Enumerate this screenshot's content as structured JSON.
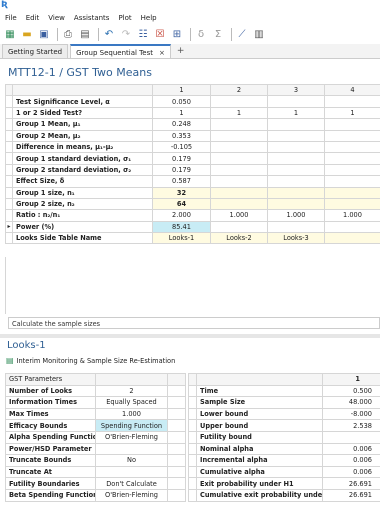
{
  "menu": [
    "File",
    "Edit",
    "View",
    "Assistants",
    "Plot",
    "Help"
  ],
  "tabs": [
    {
      "label": "Getting Started",
      "active": false
    },
    {
      "label": "Group Sequential Test",
      "active": true
    }
  ],
  "tab_add": "+",
  "doc_title": "MTT12-1 / GST Two Means",
  "main_grid": {
    "columns": [
      "",
      "1",
      "2",
      "3",
      "4"
    ],
    "rows": [
      {
        "label": "Test Significance Level, α",
        "values": [
          "0.050",
          "",
          "",
          ""
        ]
      },
      {
        "label": "1 or 2 Sided Test?",
        "values": [
          "1",
          "1",
          "1",
          "1"
        ]
      },
      {
        "label": "Group 1 Mean, μ₁",
        "values": [
          "0.248",
          "",
          "",
          ""
        ]
      },
      {
        "label": "Group 2 Mean, μ₂",
        "values": [
          "0.353",
          "",
          "",
          ""
        ]
      },
      {
        "label": "Difference in means, μ₁-μ₂",
        "values": [
          "-0.105",
          "",
          "",
          ""
        ]
      },
      {
        "label": "Group 1 standard deviation, σ₁",
        "values": [
          "0.179",
          "",
          "",
          ""
        ]
      },
      {
        "label": "Group 2 standard deviation, σ₂",
        "values": [
          "0.179",
          "",
          "",
          ""
        ]
      },
      {
        "label": "Effect Size, δ",
        "values": [
          "0.587",
          "",
          "",
          ""
        ]
      },
      {
        "label": "Group 1 size, n₁",
        "values": [
          "32",
          "",
          "",
          ""
        ]
      },
      {
        "label": "Group 2 size, n₂",
        "values": [
          "64",
          "",
          "",
          ""
        ]
      },
      {
        "label": "Ratio : n₂/n₁",
        "values": [
          "2.000",
          "1.000",
          "1.000",
          "1.000"
        ]
      },
      {
        "label": "Power (%)",
        "values": [
          "85.41",
          "",
          "",
          ""
        ]
      },
      {
        "label": "Looks Side Table Name",
        "values": [
          "Looks-1",
          "Looks-2",
          "Looks-3",
          ""
        ]
      }
    ]
  },
  "status_text": "Calculate the sample sizes",
  "looks_title": "Looks-1",
  "looks_subtitle": "Interim Monitoring & Sample Size Re-Estimation",
  "gst_params": {
    "header": "GST Parameters",
    "rows": [
      {
        "label": "Number of Looks",
        "value": "2"
      },
      {
        "label": "Information Times",
        "value": "Equally Spaced"
      },
      {
        "label": "Max Times",
        "value": "1.000"
      },
      {
        "label": "Efficacy Bounds",
        "value": "Spending Function"
      },
      {
        "label": "Alpha Spending Function",
        "value": "O'Brien-Fleming"
      },
      {
        "label": "Power/HSD Parameter",
        "value": ""
      },
      {
        "label": "Truncate Bounds",
        "value": "No"
      },
      {
        "label": "Truncate At",
        "value": ""
      },
      {
        "label": "Futility Boundaries",
        "value": "Don't Calculate"
      },
      {
        "label": "Beta Spending Function",
        "value": "O'Brien-Fleming"
      }
    ]
  },
  "looks_results": {
    "column": "1",
    "rows": [
      {
        "label": "Time",
        "value": "0.500"
      },
      {
        "label": "Sample Size",
        "value": "48.000"
      },
      {
        "label": "Lower bound",
        "value": "-8.000"
      },
      {
        "label": "Upper bound",
        "value": "2.538"
      },
      {
        "label": "Futility bound",
        "value": ""
      },
      {
        "label": "Nominal alpha",
        "value": "0.006"
      },
      {
        "label": "Incremental alpha",
        "value": "0.006"
      },
      {
        "label": "Cumulative alpha",
        "value": "0.006"
      },
      {
        "label": "Exit probability under H1",
        "value": "26.691"
      },
      {
        "label": "Cumulative exit probability under H1",
        "value": "26.691"
      }
    ]
  },
  "colors": {
    "title_blue": "#2f5f93",
    "input_yellow": "#fffbe1",
    "result_cyan": "#c8ecf5",
    "tab_accent": "#3a78c3"
  }
}
